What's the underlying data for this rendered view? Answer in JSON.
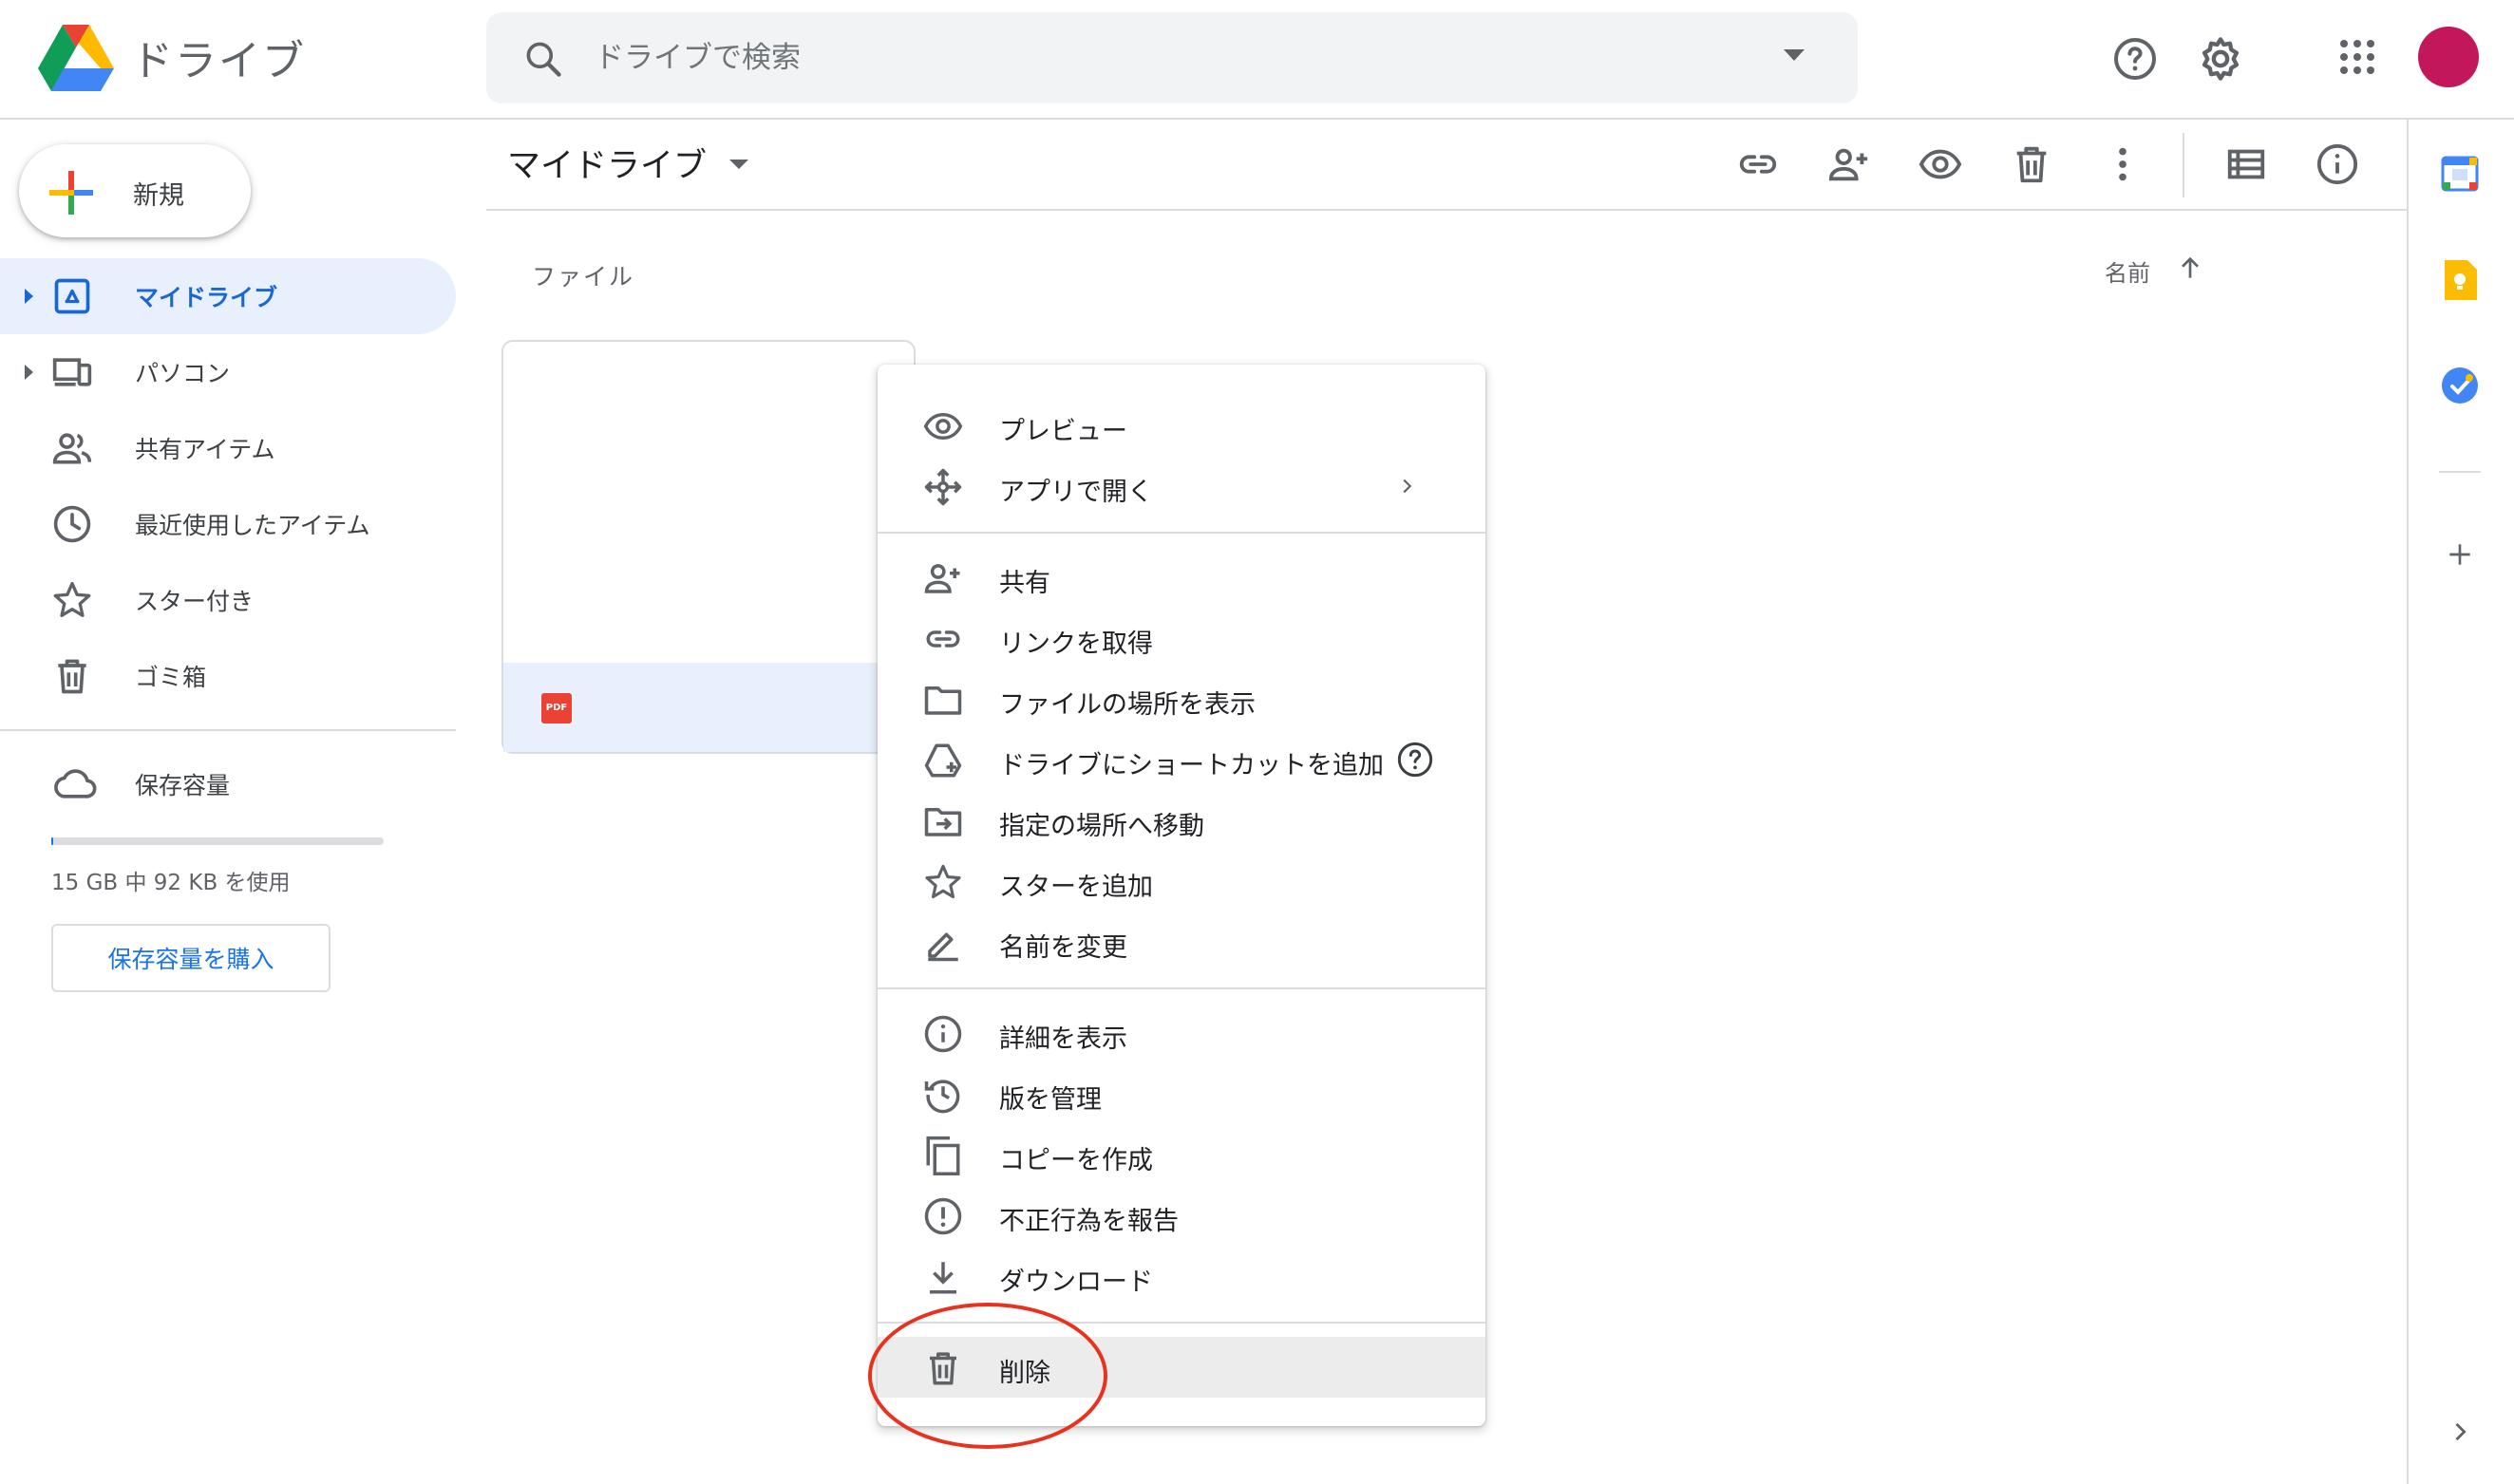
{
  "app": {
    "title": "ドライブ"
  },
  "search": {
    "placeholder": "ドライブで検索"
  },
  "sidebar": {
    "new_label": "新規",
    "items": [
      {
        "label": "マイドライブ",
        "icon": "my-drive-icon",
        "active": true,
        "expandable": true
      },
      {
        "label": "パソコン",
        "icon": "computer-icon",
        "active": false,
        "expandable": true
      },
      {
        "label": "共有アイテム",
        "icon": "shared-people-icon",
        "active": false,
        "expandable": false
      },
      {
        "label": "最近使用したアイテム",
        "icon": "clock-icon",
        "active": false,
        "expandable": false
      },
      {
        "label": "スター付き",
        "icon": "star-icon",
        "active": false,
        "expandable": false
      },
      {
        "label": "ゴミ箱",
        "icon": "trash-icon",
        "active": false,
        "expandable": false
      }
    ],
    "storage": {
      "label": "保存容量",
      "usage": "15 GB 中 92 KB を使用",
      "used_fraction": 0.0006,
      "buy_label": "保存容量を購入"
    }
  },
  "main": {
    "title": "マイドライブ",
    "files_heading": "ファイル",
    "sort_label": "名前",
    "file_badge": "PDF"
  },
  "context_menu": {
    "items": [
      {
        "label": "プレビュー",
        "icon": "eye-icon"
      },
      {
        "label": "アプリで開く",
        "icon": "move-arrows-icon",
        "submenu": true
      },
      {
        "label": "共有",
        "icon": "person-add-icon"
      },
      {
        "label": "リンクを取得",
        "icon": "link-icon"
      },
      {
        "label": "ファイルの場所を表示",
        "icon": "folder-icon"
      },
      {
        "label": "ドライブにショートカットを追加",
        "icon": "drive-shortcut-icon",
        "help": true
      },
      {
        "label": "指定の場所へ移動",
        "icon": "move-to-folder-icon"
      },
      {
        "label": "スターを追加",
        "icon": "star-icon"
      },
      {
        "label": "名前を変更",
        "icon": "pencil-icon"
      },
      {
        "label": "詳細を表示",
        "icon": "info-icon"
      },
      {
        "label": "版を管理",
        "icon": "history-icon"
      },
      {
        "label": "コピーを作成",
        "icon": "copy-icon"
      },
      {
        "label": "不正行為を報告",
        "icon": "report-icon"
      },
      {
        "label": "ダウンロード",
        "icon": "download-icon"
      },
      {
        "label": "削除",
        "icon": "trash-icon",
        "highlighted": true
      }
    ]
  },
  "colors": {
    "accent": "#1a73e8",
    "active_nav_bg": "#e8f0fe",
    "avatar": "#c2185b",
    "highlight_ring": "#e8321e"
  }
}
